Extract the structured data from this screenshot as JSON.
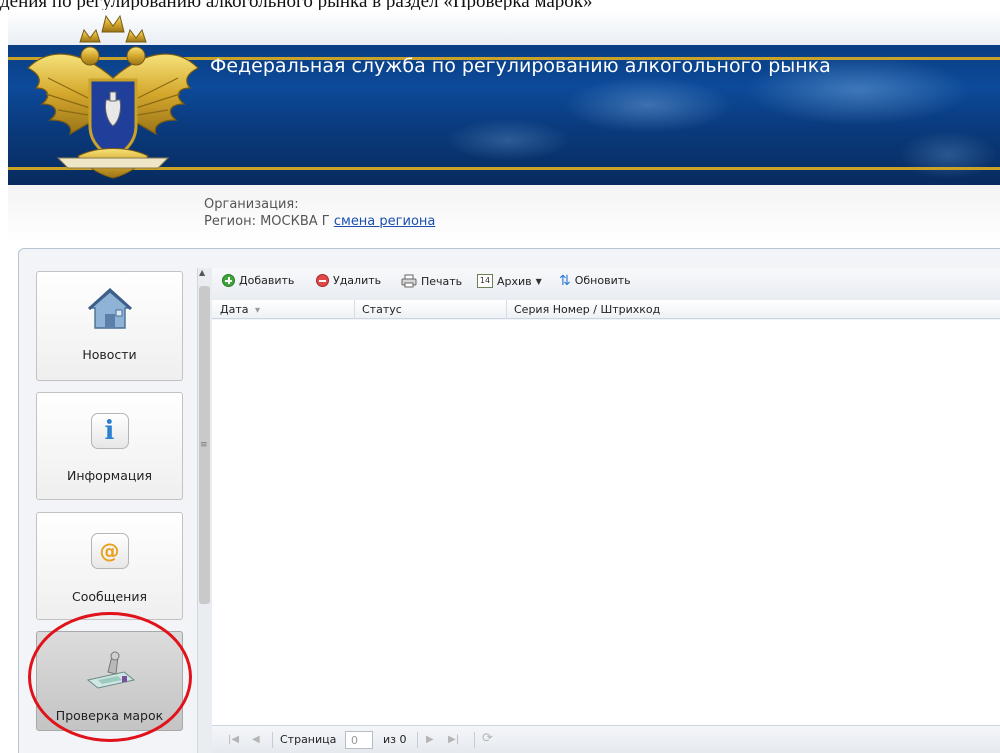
{
  "document_caption": "дения по регулированию алкогольного рынка в раздел «Проверка марок»",
  "banner": {
    "title": "Федеральная служба по регулированию алкогольного рынка"
  },
  "org_info": {
    "organization_label": "Организация:",
    "region_label": "Регион: МОСКВА Г",
    "change_region_link": "смена региона"
  },
  "side_menu": [
    {
      "label": "Новости",
      "icon": "house-icon"
    },
    {
      "label": "Информация",
      "icon": "info-icon"
    },
    {
      "label": "Сообщения",
      "icon": "at-sign-icon"
    },
    {
      "label": "Проверка марок",
      "icon": "stamp-scanner-icon",
      "active": true
    }
  ],
  "toolbar": {
    "add": "Добавить",
    "delete": "Удалить",
    "print": "Печать",
    "archive": "Архив",
    "archive_icon_text": "14",
    "refresh": "Обновить"
  },
  "grid": {
    "columns": [
      "Дата",
      "Статус",
      "Серия Номер / Штрихкод"
    ],
    "sort_indicator": "▾",
    "rows": []
  },
  "paging": {
    "page_label": "Страница",
    "page_value": "0",
    "of_label": "из 0"
  },
  "colors": {
    "banner_blue": "#0a3d82",
    "gold_stripe": "#c9a227",
    "highlight_red": "#e0131b",
    "link_blue": "#1a4fb0"
  }
}
